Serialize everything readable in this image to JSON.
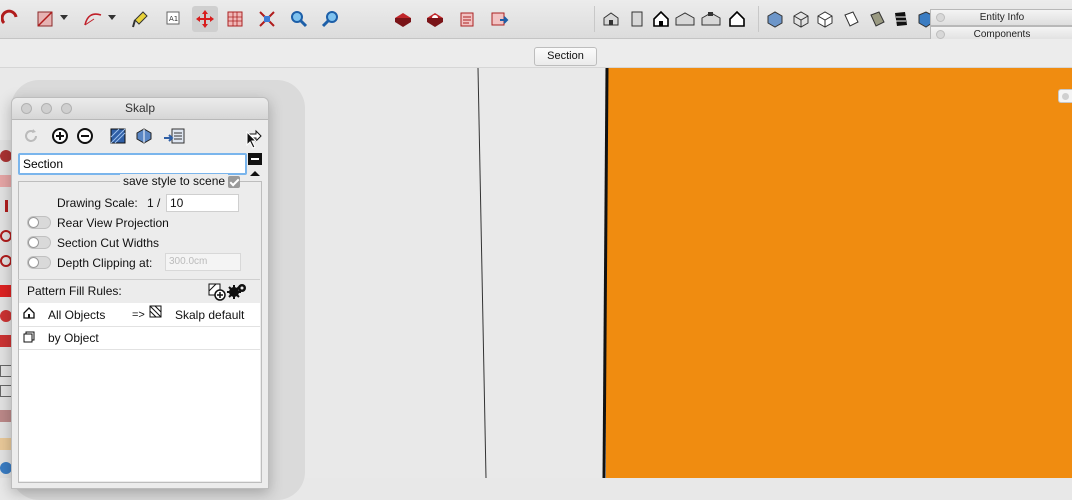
{
  "scene": {
    "tab_label": "Section"
  },
  "trays": {
    "entity_info": "Entity Info",
    "components": "Components"
  },
  "toolbar": {
    "groups": [
      "draw-tools",
      "edit-tools",
      "view-tools",
      "warehouse-tools",
      "standard-views",
      "face-styles"
    ]
  },
  "skalp": {
    "title": "Skalp",
    "section_name_value": "Section",
    "save_style_label": "save style to scene",
    "save_style_checked": true,
    "drawing_scale_label": "Drawing Scale:",
    "drawing_scale_prefix": "1 /",
    "drawing_scale_value": "10",
    "rear_view_label": "Rear View Projection",
    "section_cut_widths_label": "Section Cut Widths",
    "depth_clipping_label": "Depth Clipping at:",
    "depth_clipping_placeholder": "300.0cm",
    "pattern_fill_rules_label": "Pattern Fill Rules:",
    "rules": [
      {
        "name": "All Objects",
        "arrow": "=>",
        "style": "Skalp default"
      },
      {
        "name": "by Object",
        "arrow": "",
        "style": ""
      }
    ]
  },
  "colors": {
    "section_fill": "#f08c10",
    "focus_ring": "#7ab5ec"
  }
}
